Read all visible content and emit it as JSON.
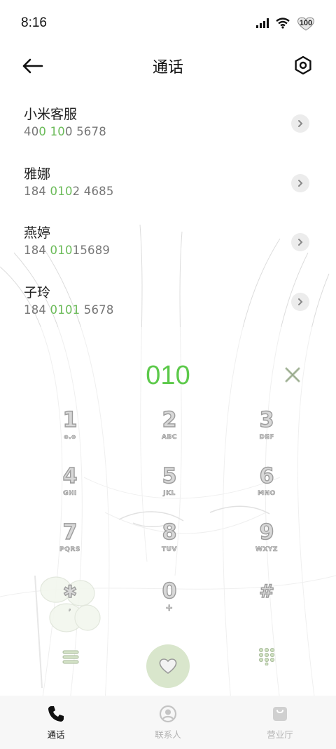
{
  "status_bar": {
    "time": "8:16",
    "battery": "100"
  },
  "header": {
    "title": "通话"
  },
  "contacts": [
    {
      "name": "小米客服",
      "number_parts": [
        [
          "40",
          false
        ],
        [
          "0",
          true
        ],
        [
          " ",
          false
        ],
        [
          "10",
          true
        ],
        [
          "0 5678",
          false
        ]
      ]
    },
    {
      "name": "雅娜",
      "number_parts": [
        [
          "184 ",
          false
        ],
        [
          "010",
          true
        ],
        [
          "2 4685",
          false
        ]
      ]
    },
    {
      "name": "燕婷",
      "number_parts": [
        [
          "184 ",
          false
        ],
        [
          "010",
          true
        ],
        [
          "15689",
          false
        ]
      ]
    },
    {
      "name": "子玲",
      "number_parts": [
        [
          "184 ",
          false
        ],
        [
          "0101",
          true
        ],
        [
          " 5678",
          false
        ]
      ]
    }
  ],
  "dialer": {
    "display": "010",
    "keys": [
      {
        "digit": "1",
        "letters": "o.o"
      },
      {
        "digit": "2",
        "letters": "ABC"
      },
      {
        "digit": "3",
        "letters": "DEF"
      },
      {
        "digit": "4",
        "letters": "GHI"
      },
      {
        "digit": "5",
        "letters": "JKL"
      },
      {
        "digit": "6",
        "letters": "MNO"
      },
      {
        "digit": "7",
        "letters": "PQRS"
      },
      {
        "digit": "8",
        "letters": "TUV"
      },
      {
        "digit": "9",
        "letters": "WXYZ"
      },
      {
        "digit": "✱",
        "letters": ","
      },
      {
        "digit": "0",
        "letters": "+"
      },
      {
        "digit": "#",
        "letters": ""
      }
    ]
  },
  "bottom_nav": [
    {
      "label": "通话",
      "icon": "phone-icon",
      "active": true
    },
    {
      "label": "联系人",
      "icon": "person-icon",
      "active": false
    },
    {
      "label": "营业厅",
      "icon": "bag-icon",
      "active": false
    }
  ],
  "colors": {
    "accent": "#5cc94a",
    "call_button": "#d9e6cc"
  }
}
